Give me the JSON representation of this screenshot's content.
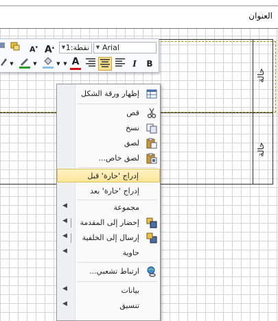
{
  "diagram": {
    "title": "العنوان",
    "lanes": [
      {
        "label": "حالة"
      },
      {
        "label": "حالة"
      }
    ]
  },
  "mini_toolbar": {
    "font_name": "Arial",
    "font_size": "1:نقطة",
    "grow_font_label": "A",
    "shrink_font_label": "A",
    "bold_label": "B",
    "italic_label": "I",
    "font_color_label": "A"
  },
  "context_menu": {
    "items": [
      {
        "label": "إظهار ورقة الشكل"
      },
      {
        "label": "قص"
      },
      {
        "label": "نسخ"
      },
      {
        "label": "لصق"
      },
      {
        "label": "لصق خاص..."
      },
      {
        "label": "إدراج 'حارة' قبل"
      },
      {
        "label": "إدراج 'حارة' بعد"
      },
      {
        "label": "مجموعة"
      },
      {
        "label": "إحضار إلى المقدمة"
      },
      {
        "label": "إرسال إلى الخلفية"
      },
      {
        "label": "حاوية"
      },
      {
        "label": "ارتباط تشعبي..."
      },
      {
        "label": "بيانات"
      },
      {
        "label": "تنسيق"
      }
    ]
  },
  "colors": {
    "highlight": "#fde69a",
    "selection_dash": "#b08a00",
    "font_color_bar": "#d01010",
    "fill_color_bar": "#2e9b2e"
  }
}
